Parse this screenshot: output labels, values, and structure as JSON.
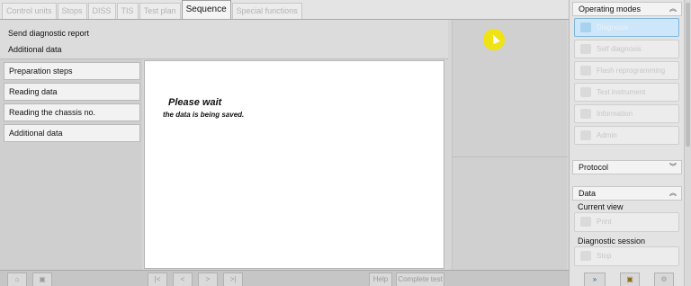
{
  "tabs": [
    {
      "label": "Control units",
      "active": false
    },
    {
      "label": "Stops",
      "active": false
    },
    {
      "label": "DISS",
      "active": false
    },
    {
      "label": "TIS",
      "active": false
    },
    {
      "label": "Test plan",
      "active": false
    },
    {
      "label": "Sequence",
      "active": true
    },
    {
      "label": "Special functions",
      "active": false
    }
  ],
  "header": {
    "line1": "Send diagnostic report",
    "line2": "Additional data"
  },
  "steps": [
    {
      "label": "Preparation steps"
    },
    {
      "label": "Reading data"
    },
    {
      "label": "Reading the chassis no."
    },
    {
      "label": "Additional data"
    }
  ],
  "message": {
    "title": "Please wait",
    "subtitle": "the data is being saved."
  },
  "bottom": {
    "help_label": "Help",
    "complete_label": "Complete test"
  },
  "side": {
    "operating_modes": "Operating modes",
    "modes": [
      {
        "label": "Diagnosis",
        "icon": "diagnosis-icon",
        "active": true
      },
      {
        "label": "Self diagnosis",
        "icon": "self-diagnosis-icon",
        "active": false
      },
      {
        "label": "Flash reprogramming",
        "icon": "flash-icon",
        "active": false
      },
      {
        "label": "Test instrument",
        "icon": "test-instrument-icon",
        "active": false
      },
      {
        "label": "Information",
        "icon": "information-icon",
        "active": false
      },
      {
        "label": "Admin",
        "icon": "admin-icon",
        "active": false
      }
    ],
    "protocol": "Protocol",
    "data": "Data",
    "current_view": "Current view",
    "print": "Print",
    "diagnostic_session": "Diagnostic session",
    "stop": "Stop"
  },
  "colors": {
    "active_mode_bg": "#cde6f9",
    "cursor_highlight": "#f3e600"
  }
}
